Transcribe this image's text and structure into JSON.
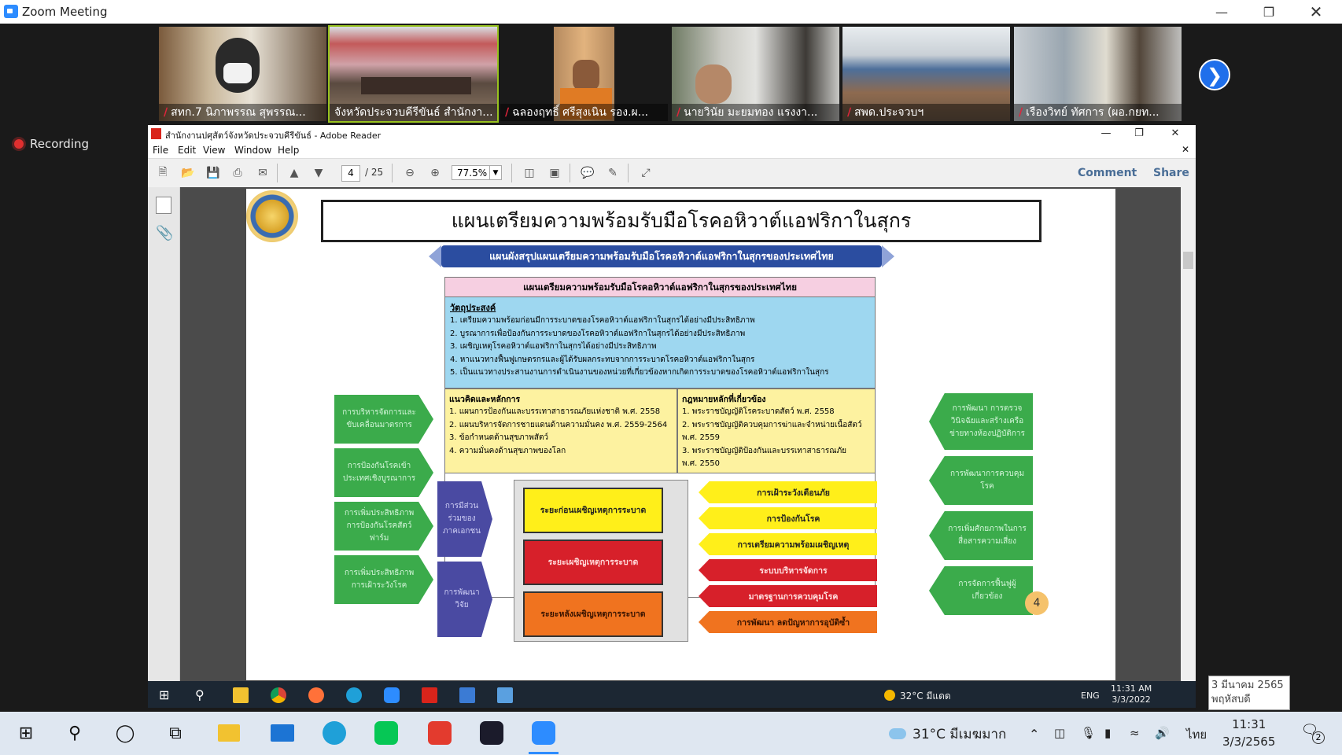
{
  "zoom": {
    "window_title": "Zoom Meeting",
    "recording_label": "Recording",
    "participants": [
      {
        "name": "สทก.7 นิภาพรรณ สุพรรณ...",
        "muted": true
      },
      {
        "name": "จังหวัดประจวบคีรีขันธ์ สำนักงา...",
        "muted": false,
        "active": true
      },
      {
        "name": "ฉลองฤทธิ์ ศรีสุงเนิน รอง.ผ...",
        "muted": true
      },
      {
        "name": "นายวินัย มะยมทอง  แรงงา...",
        "muted": true
      },
      {
        "name": "สพด.ประจวบฯ",
        "muted": true
      },
      {
        "name": "เรืองวิทย์ ทัศการ (ผอ.กยท...",
        "muted": true
      }
    ]
  },
  "reader": {
    "window_title": "สำนักงานปศุสัตว์จังหวัดประจวบคีรีขันธ์ - Adobe Reader",
    "menu": [
      "File",
      "Edit",
      "View",
      "Window",
      "Help"
    ],
    "page_current": "4",
    "page_total": "/ 25",
    "zoom_value": "77.5%",
    "comment_label": "Comment",
    "share_label": "Share"
  },
  "slide": {
    "title": "แผนเตรียมความพร้อมรับมือโรคอหิวาต์แอฟริกาในสุกร",
    "banner": "แผนผังสรุปแผนเตรียมความพร้อมรับมือโรคอหิวาต์แอฟริกาในสุกรของประเทศไทย",
    "plan_heading": "แผนเตรียมความพร้อมรับมือโรคอหิวาต์แอฟริกาในสุกรของประเทศไทย",
    "objectives_title": "วัตถุประสงค์",
    "objectives": [
      "1.  เตรียมความพร้อมก่อนมีการระบาดของโรคอหิวาต์แอฟริกาในสุกรได้อย่างมีประสิทธิภาพ",
      "2.  บูรณาการเพื่อป้องกันการระบาดของโรคอหิวาต์แอฟริกาในสุกรได้อย่างมีประสิทธิภาพ",
      "3.  เผชิญเหตุโรคอหิวาต์แอฟริกาในสุกรได้อย่างมีประสิทธิภาพ",
      "4.  หาแนวทางฟื้นฟูเกษตรกรและผู้ได้รับผลกระทบจากการระบาดโรคอหิวาต์แอฟริกาในสุกร",
      "5.  เป็นแนวทางประสานงานการดำเนินงานของหน่วยที่เกี่ยวข้องหากเกิดการระบาดของโรคอหิวาต์แอฟริกาในสุกร"
    ],
    "concepts_title": "แนวคิดและหลักการ",
    "concepts": [
      "1.  แผนการป้องกันและบรรเทาสาธารณภัยแห่งชาติ พ.ศ. 2558",
      "2.  แผนบริหารจัดการชายแดนด้านความมั่นคง พ.ศ. 2559-2564",
      "3.  ข้อกำหนดด้านสุขภาพสัตว์",
      "4.  ความมั่นคงด้านสุขภาพของโลก"
    ],
    "laws_title": "กฎหมายหลักที่เกี่ยวข้อง",
    "laws": [
      "1.  พระราชบัญญัติโรคระบาดสัตว์ พ.ศ. 2558",
      "2.  พระราชบัญญัติควบคุมการฆ่าและจำหน่ายเนื้อสัตว์",
      "พ.ศ. 2559",
      "3.  พระราชบัญญัติป้องกันและบรรเทาสาธารณภัย",
      "พ.ศ. 2550"
    ],
    "left_arrows": [
      "การบริหารจัดการและขับเคลื่อนมาตรการ",
      "การป้องกันโรคเข้าประเทศเชิงบูรณาการ",
      "การเพิ่มประสิทธิภาพการป้องกันโรคสัตว์ฟาร์ม",
      "การเพิ่มประสิทธิภาพการเฝ้าระวังโรค"
    ],
    "purple_arrows": [
      "การมีส่วนร่วมของภาคเอกชน",
      "การพัฒนาวิจัย"
    ],
    "phases": [
      {
        "label": "ระยะก่อนเผชิญเหตุการระบาด",
        "color": "#ffef1a",
        "text": "#222"
      },
      {
        "label": "ระยะเผชิญเหตุการระบาด",
        "color": "#d7202a",
        "text": "#ffd9d9"
      },
      {
        "label": "ระยะหลังเผชิญเหตุการระบาด",
        "color": "#f0731f",
        "text": "#3a1400"
      }
    ],
    "right_arrows": [
      {
        "label": "การเฝ้าระวังเตือนภัย",
        "color": "#ffef1a",
        "text": "#222"
      },
      {
        "label": "การป้องกันโรค",
        "color": "#ffef1a",
        "text": "#222"
      },
      {
        "label": "การเตรียมความพร้อมเผชิญเหตุ",
        "color": "#ffef1a",
        "text": "#222"
      },
      {
        "label": "ระบบบริหารจัดการ",
        "color": "#d7202a",
        "text": "#ffe0e0"
      },
      {
        "label": "มาตรฐานการควบคุมโรค",
        "color": "#d7202a",
        "text": "#ffe0e0"
      },
      {
        "label": "การพัฒนา ลดปัญหาการอุบัติซ้ำ",
        "color": "#f0731f",
        "text": "#3a1400"
      }
    ],
    "far_right_arrows": [
      "การพัฒนา การตรวจวินิจฉัยและสร้างเครือข่ายทางห้องปฏิบัติการ",
      "การพัฒนาการควบคุมโรค",
      "การเพิ่มศักยภาพในการสื่อสารความเสี่ยง",
      "การจัดการฟื้นฟูผู้เกี่ยวข้อง"
    ],
    "page_number": "4"
  },
  "inner_taskbar": {
    "weather": "32°C  มีแดด",
    "lang": "ENG",
    "time": "11:31 AM",
    "date": "3/3/2022",
    "tooltip_date": "3 มีนาคม 2565",
    "tooltip_day": "พฤหัสบดี"
  },
  "taskbar": {
    "weather": "31°C  มีเมฆมาก",
    "lang": "ไทย",
    "time": "11:31",
    "date": "3/3/2565",
    "notifications": "2"
  },
  "colors": {
    "zoom_blue": "#2d8cff",
    "green_arrow": "#3bab4b",
    "banner_blue": "#2b4da0",
    "objectives_bg": "#9ed7f0",
    "concepts_bg": "#fdf2a0"
  }
}
